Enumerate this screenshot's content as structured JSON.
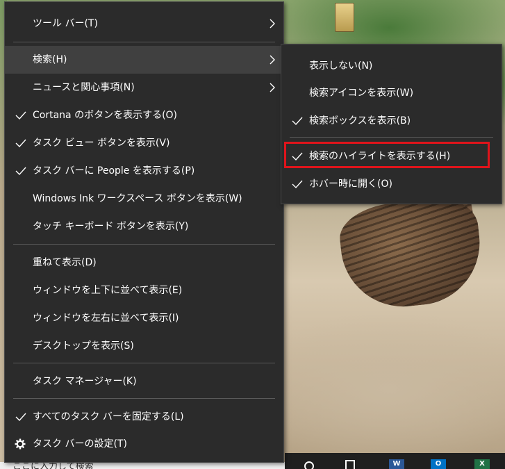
{
  "desktop": {
    "search_placeholder": "ここに入力して検索"
  },
  "taskbar": {
    "word_label": "W",
    "outlook_label": "O",
    "excel_label": "X"
  },
  "main_menu": {
    "items": [
      {
        "label": "ツール バー(T)",
        "checked": false,
        "submenu": true
      },
      {
        "label": "検索(H)",
        "checked": false,
        "submenu": true,
        "highlighted": true
      },
      {
        "label": "ニュースと関心事項(N)",
        "checked": false,
        "submenu": true
      },
      {
        "label": "Cortana のボタンを表示する(O)",
        "checked": true
      },
      {
        "label": "タスク ビュー ボタンを表示(V)",
        "checked": true
      },
      {
        "label": "タスク バーに People を表示する(P)",
        "checked": true
      },
      {
        "label": "Windows Ink ワークスペース ボタンを表示(W)",
        "checked": false
      },
      {
        "label": "タッチ キーボード ボタンを表示(Y)",
        "checked": false
      },
      {
        "label": "重ねて表示(D)",
        "checked": false
      },
      {
        "label": "ウィンドウを上下に並べて表示(E)",
        "checked": false
      },
      {
        "label": "ウィンドウを左右に並べて表示(I)",
        "checked": false
      },
      {
        "label": "デスクトップを表示(S)",
        "checked": false
      },
      {
        "label": "タスク マネージャー(K)",
        "checked": false
      },
      {
        "label": "すべてのタスク バーを固定する(L)",
        "checked": true
      },
      {
        "label": "タスク バーの設定(T)",
        "icon": "gear-icon"
      }
    ]
  },
  "sub_menu": {
    "items": [
      {
        "label": "表示しない(N)",
        "checked": false
      },
      {
        "label": "検索アイコンを表示(W)",
        "checked": false
      },
      {
        "label": "検索ボックスを表示(B)",
        "checked": true
      },
      {
        "label": "検索のハイライトを表示する(H)",
        "checked": true,
        "annotated": true
      },
      {
        "label": "ホバー時に開く(O)",
        "checked": true
      }
    ]
  },
  "colors": {
    "menu_bg": "#2b2b2b",
    "menu_hover": "#404040",
    "annotation_red": "#e0141b"
  }
}
